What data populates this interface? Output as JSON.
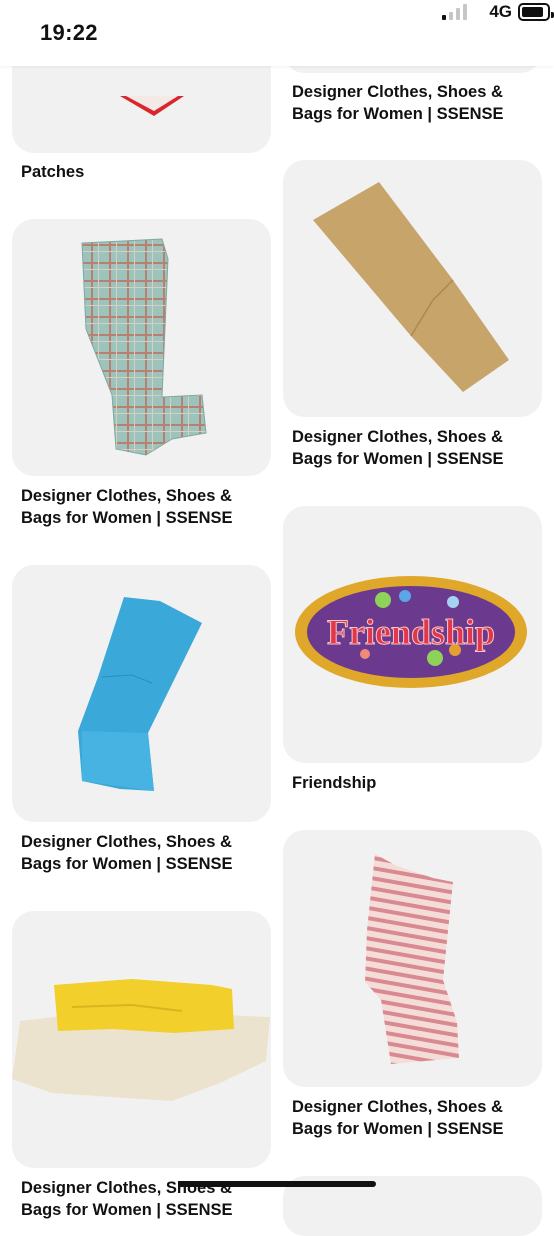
{
  "status_bar": {
    "time": "19:22",
    "network": "4G",
    "signal_bars_active": 1,
    "signal_bars_total": 4
  },
  "pins": [
    {
      "title": "Patches",
      "image": "red-patch-image"
    },
    {
      "title": "Designer Clothes, Shoes & Bags for Women | SSENSE",
      "image": "tape-image"
    },
    {
      "title": "Designer Clothes, Shoes & Bags for Women | SSENSE",
      "image": "plaid-tape-image"
    },
    {
      "title": "Designer Clothes, Shoes & Bags for Women | SSENSE",
      "image": "kraft-tape-image"
    },
    {
      "title": "Designer Clothes, Shoes & Bags for Women | SSENSE",
      "image": "blue-tape-image"
    },
    {
      "title": "Friendship",
      "image": "friendship-patch-image",
      "patch_text": "Friendship"
    },
    {
      "title": "Designer Clothes, Shoes & Bags for Women | SSENSE",
      "image": "yellow-beige-tape-image"
    },
    {
      "title": "Designer Clothes, Shoes & Bags for Women | SSENSE",
      "image": "pink-striped-tape-image"
    },
    {
      "title": "",
      "image": "partial-card"
    }
  ],
  "colors": {
    "card_bg": "#f2f1f1",
    "patch_red": "#d9272e",
    "plaid_teal": "#8fb9b3",
    "kraft": "#c7a469",
    "blue_tape": "#3aa8d8",
    "friendship_purple": "#6b3a8e",
    "friendship_gold": "#e0a82a",
    "friendship_red": "#e2364a",
    "yellow_tape": "#f2cf2a",
    "beige_tape": "#ece3cf",
    "pink_stripe": "#d98a90"
  }
}
